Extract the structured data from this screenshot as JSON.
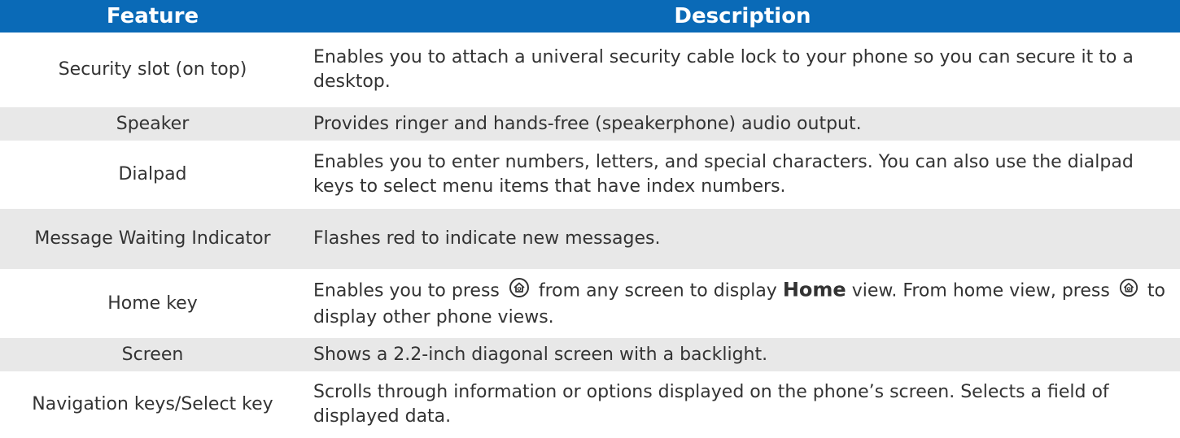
{
  "header": {
    "feature": "Feature",
    "description": "Description"
  },
  "rows": [
    {
      "feature": "Security slot (on top)",
      "description": "Enables you to attach a univeral security cable lock to your phone so you can secure it to a desktop."
    },
    {
      "feature": "Speaker",
      "description": "Provides ringer and hands-free (speakerphone) audio output."
    },
    {
      "feature": "Dialpad",
      "description": "Enables you to enter numbers, letters, and special characters. You can also use the dialpad keys to select menu items that have index numbers."
    },
    {
      "feature": "Message Waiting Indicator",
      "description": "Flashes red to indicate new messages."
    },
    {
      "feature": "Home key",
      "description_parts": {
        "a": "Enables you to press",
        "b": "from any screen to display",
        "bold": "Home",
        "c": "view. From home view, press",
        "d": "to display other phone views."
      }
    },
    {
      "feature": "Screen",
      "description": "Shows a 2.2-inch diagonal screen with a backlight."
    },
    {
      "feature": "Navigation keys/Select key",
      "description": "Scrolls through information or options displayed on the phone’s screen. Selects a field of displayed data."
    }
  ],
  "colors": {
    "header_bg": "#0a6ab7",
    "header_text": "#ffffff",
    "shade_row": "#e8e8e8",
    "text": "#333333"
  },
  "icons": {
    "home_key": "home-key-icon"
  }
}
